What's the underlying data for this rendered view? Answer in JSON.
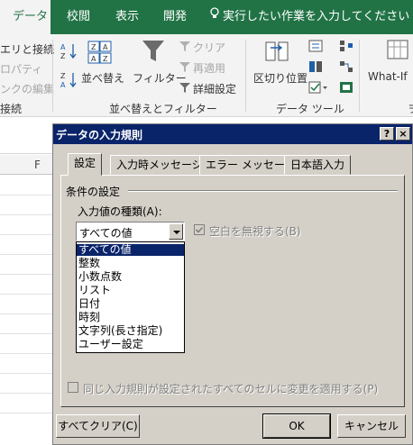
{
  "ribbon": {
    "tabs": [
      {
        "label": "データ",
        "active": true
      },
      {
        "label": "校閲"
      },
      {
        "label": "表示"
      },
      {
        "label": "開発"
      }
    ],
    "tell_me": "実行したい作業を入力してください",
    "left_items": [
      "エリと接続",
      "ロパティ",
      "ンクの編集"
    ],
    "left_group": "接続",
    "sort_az": "A↓Z",
    "sort_za": "Z↓A",
    "sort_label": "並べ替え",
    "filter_label": "フィルター",
    "clear_label": "クリア",
    "reapply_label": "再適用",
    "advanced_label": "詳細設定",
    "sort_filter_group": "並べ替えとフィルター",
    "text_to_columns": "区切り位置",
    "data_tools_group": "データ ツール",
    "whatif_label": "What-If",
    "next_group": "ヲ"
  },
  "sheet": {
    "column_header": "F"
  },
  "dialog": {
    "title": "データの入力規則",
    "help_btn": "?",
    "close_btn": "×",
    "tabs": [
      "設定",
      "入力時メッセージ",
      "エラー メッセージ",
      "日本語入力"
    ],
    "section": "条件の設定",
    "field_label": "入力値の種類(A):",
    "field_value": "すべての値",
    "ignore_blank": "空白を無視する(B)",
    "options": [
      "すべての値",
      "整数",
      "小数点数",
      "リスト",
      "日付",
      "時刻",
      "文字列(長さ指定)",
      "ユーザー設定"
    ],
    "apply_all": "同じ入力規則が設定されたすべてのセルに変更を適用する(P)",
    "clear_all": "すべてクリア(C)",
    "ok": "OK",
    "cancel": "キャンセル"
  },
  "colors": {
    "ribbon_green": "#217346",
    "title_blue": "#0a246a",
    "dialog_face": "#d4d0c8"
  }
}
